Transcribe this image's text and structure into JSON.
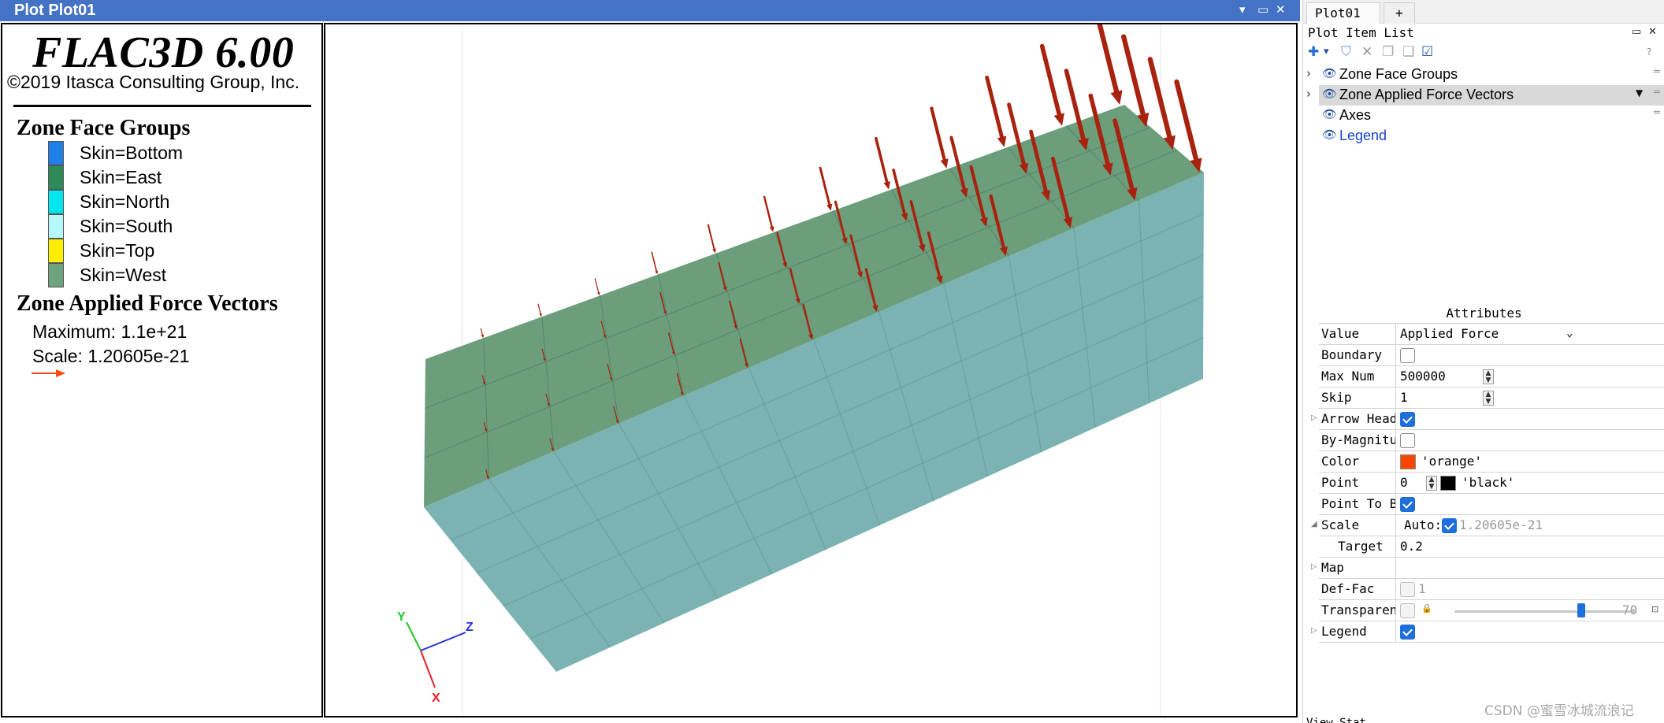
{
  "plot_window": {
    "title": "Plot Plot01",
    "controls": [
      "▾",
      "▭",
      "✕"
    ]
  },
  "legend": {
    "brand": "FLAC3D 6.00",
    "copyright": "©2019 Itasca Consulting Group, Inc.",
    "face_groups_title": "Zone Face Groups",
    "face_groups": [
      {
        "label": "Skin=Bottom",
        "color": "#1f7fe6"
      },
      {
        "label": "Skin=East",
        "color": "#2e8b57"
      },
      {
        "label": "Skin=North",
        "color": "#00e5ee"
      },
      {
        "label": "Skin=South",
        "color": "#b5f7fb"
      },
      {
        "label": "Skin=Top",
        "color": "#ffee00"
      },
      {
        "label": "Skin=West",
        "color": "#6fa27f"
      }
    ],
    "vectors_title": "Zone Applied Force Vectors",
    "maximum": "Maximum: 1.1e+21",
    "scale": "Scale: 1.20605e-21",
    "arrow_color": "#ff4a14"
  },
  "model_view": {
    "top_color": "#6c9e7c",
    "side_color": "#7ab3b2",
    "arrow_color": "#a8230f",
    "axes": {
      "x_label": "X",
      "y_label": "Y",
      "z_label": "Z",
      "x_color": "#e8202a",
      "y_color": "#22c42a",
      "z_color": "#2030e0"
    }
  },
  "tabs": {
    "active": "Plot01",
    "add": "+"
  },
  "plot_item_list": {
    "title": "Plot Item List",
    "controls": [
      "▭",
      "✕"
    ],
    "toolbar": [
      "✚",
      "▾",
      "⛉",
      "✕",
      "❐",
      "❏",
      "☑",
      "?"
    ],
    "items": [
      {
        "label": "Zone Face Groups",
        "expandable": true
      },
      {
        "label": "Zone Applied Force Vectors",
        "expandable": true,
        "selected": true
      },
      {
        "label": "Axes",
        "expandable": false
      },
      {
        "label": "Legend",
        "expandable": false,
        "link": true
      }
    ],
    "link_color": "#1a43c8"
  },
  "attributes": {
    "title": "Attributes",
    "value": {
      "name": "Value",
      "text": "Applied Force",
      "caret": "⌄"
    },
    "boundary": {
      "name": "Boundary",
      "checked": false
    },
    "max_num": {
      "name": "Max Num",
      "text": "500000"
    },
    "skip": {
      "name": "Skip",
      "text": "1"
    },
    "arrow_head": {
      "name": "Arrow Head",
      "checked": true
    },
    "by_magnitude": {
      "name": "By-Magnitude",
      "checked": false
    },
    "color": {
      "name": "Color",
      "text": "'orange'",
      "swatch": "#ff4500"
    },
    "point": {
      "name": "Point",
      "text": "0",
      "color_text": "'black'",
      "swatch": "#000000"
    },
    "point_to_base": {
      "name": "Point To Base",
      "checked": true
    },
    "scale": {
      "name": "Scale",
      "auto_label": "Auto:",
      "auto": true,
      "text": "1.20605e-21"
    },
    "target": {
      "name": "Target",
      "text": "0.2"
    },
    "map": {
      "name": "Map"
    },
    "def_fac": {
      "name": "Def-Fac",
      "text": "1",
      "checked": false
    },
    "transparency": {
      "name": "Transparency",
      "text": "70",
      "checked": false,
      "level": 0.7
    },
    "legend": {
      "name": "Legend",
      "checked": true
    }
  },
  "watermark": "CSDN @蜜雪冰城流浪记",
  "status_fragment": "View Stat"
}
